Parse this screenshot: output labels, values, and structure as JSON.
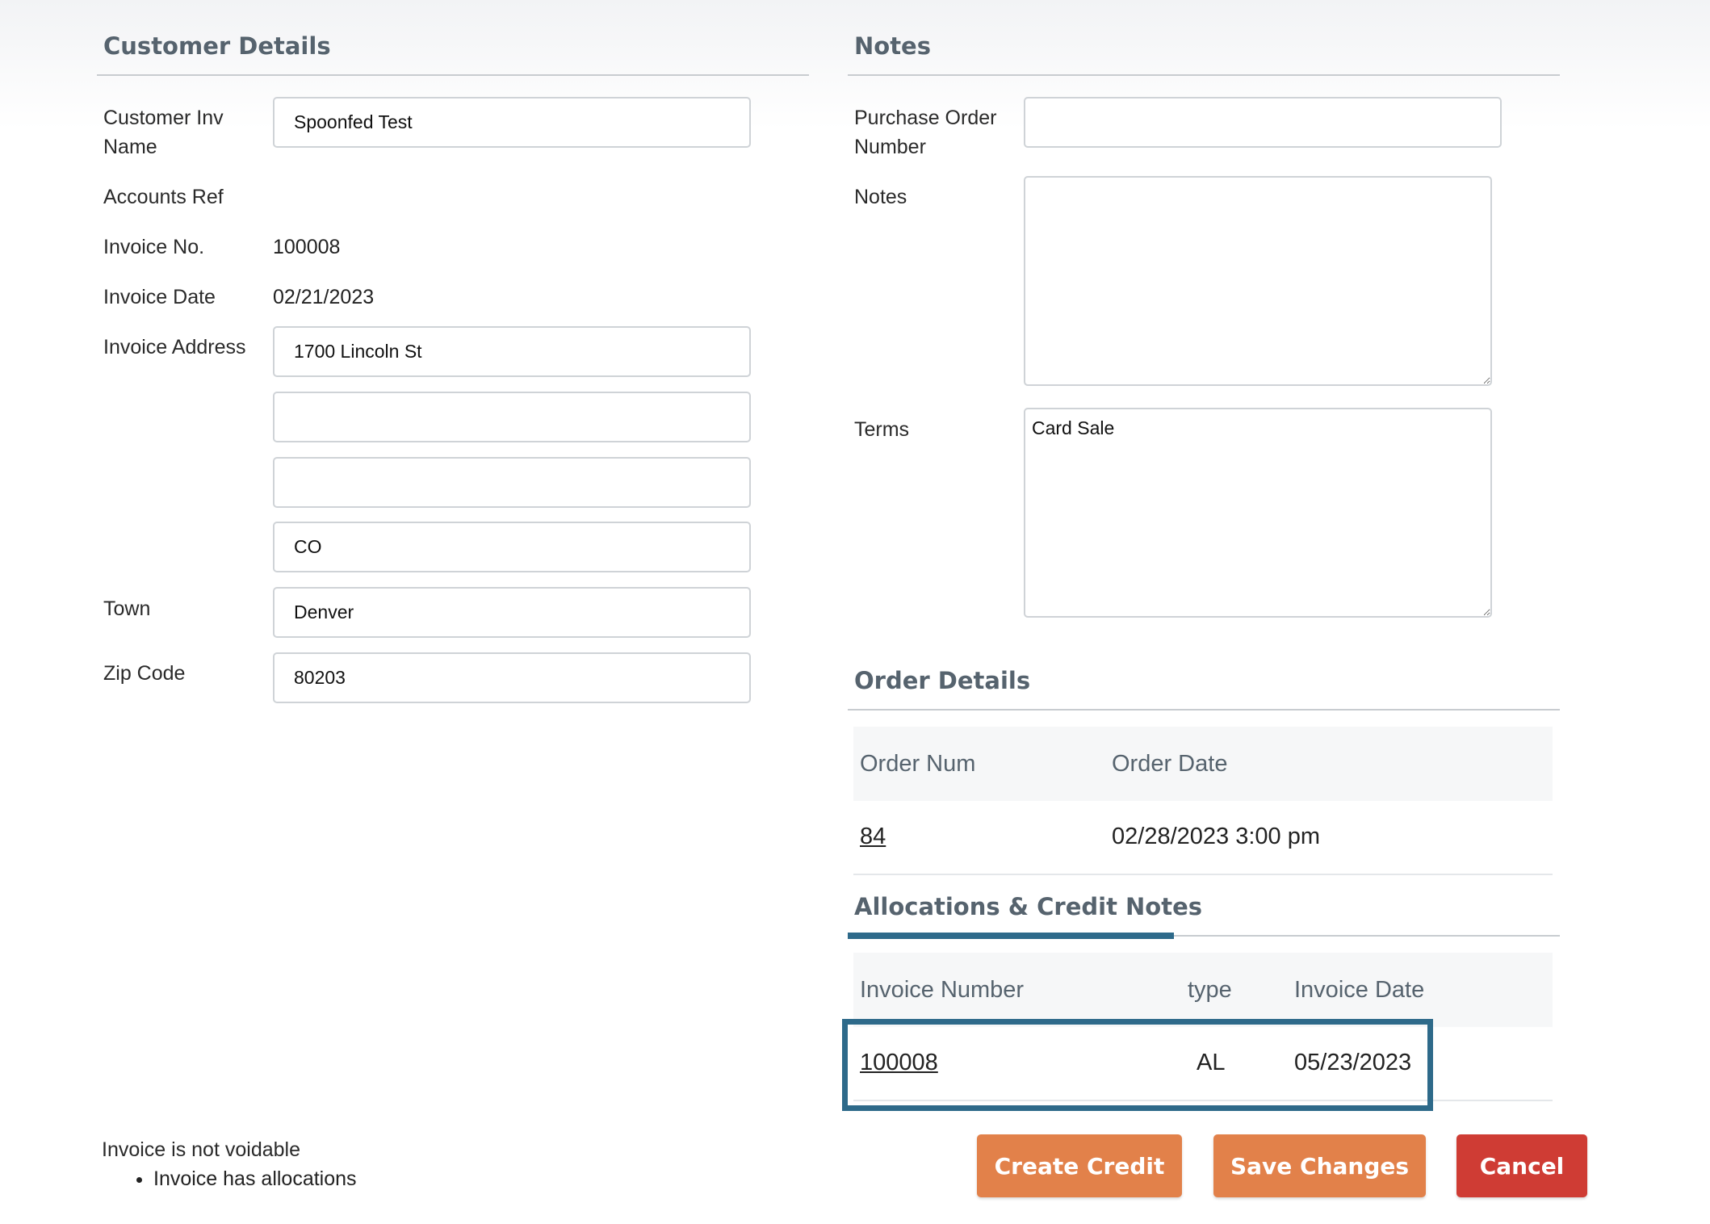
{
  "customer_details": {
    "title": "Customer Details",
    "labels": {
      "inv_name": "Customer Inv Name",
      "accounts_ref": "Accounts Ref",
      "invoice_no": "Invoice No.",
      "invoice_date": "Invoice Date",
      "invoice_address": "Invoice Address",
      "town": "Town",
      "zip": "Zip Code"
    },
    "values": {
      "inv_name": "Spoonfed Test",
      "accounts_ref": "",
      "invoice_no": "100008",
      "invoice_date": "02/21/2023",
      "address_1": "1700 Lincoln St",
      "address_2": "",
      "address_3": "",
      "address_4": "CO",
      "town": "Denver",
      "zip": "80203"
    }
  },
  "notes": {
    "title": "Notes",
    "labels": {
      "po_number": "Purchase Order Number",
      "notes": "Notes",
      "terms": "Terms"
    },
    "values": {
      "po_number": "",
      "notes": "",
      "terms": "Card Sale"
    }
  },
  "order_details": {
    "title": "Order Details",
    "columns": [
      "Order Num",
      "Order Date"
    ],
    "rows": [
      {
        "order_num": "84",
        "order_date": "02/28/2023 3:00 pm"
      }
    ]
  },
  "allocations": {
    "title": "Allocations & Credit Notes",
    "columns": [
      "Invoice Number",
      "type",
      "Invoice Date"
    ],
    "rows": [
      {
        "invoice_number": "100008",
        "type": "AL",
        "invoice_date": "05/23/2023"
      }
    ]
  },
  "void_status": {
    "message": "Invoice is not voidable",
    "reasons": [
      "Invoice has allocations"
    ]
  },
  "actions": {
    "create_credit": "Create Credit",
    "save_changes": "Save Changes",
    "cancel": "Cancel"
  },
  "colors": {
    "accent_orange": "#e2814a",
    "danger_red": "#cf3c34",
    "highlight_blue": "#2e6a8a",
    "heading_gray": "#56636e"
  }
}
